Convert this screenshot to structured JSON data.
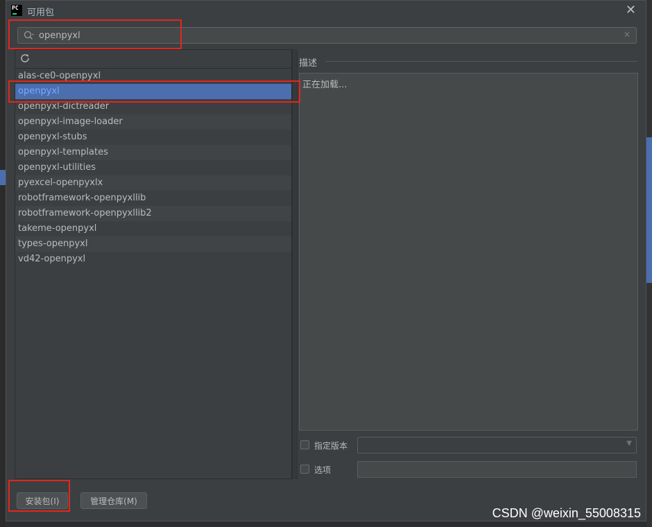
{
  "window": {
    "title": "可用包",
    "app_icon_text": "PC"
  },
  "search": {
    "value": "openpyxl"
  },
  "packages": [
    "alas-ce0-openpyxl",
    "openpyxl",
    "openpyxl-dictreader",
    "openpyxl-image-loader",
    "openpyxl-stubs",
    "openpyxl-templates",
    "openpyxl-utilities",
    "pyexcel-openpyxlx",
    "robotframework-openpyxllib",
    "robotframework-openpyxllib2",
    "takeme-openpyxl",
    "types-openpyxl",
    "vd42-openpyxl"
  ],
  "selected_package": "openpyxl",
  "description": {
    "label": "描述",
    "text": "正在加载..."
  },
  "options": {
    "specify_version_label": "指定版本",
    "options_label": "选项"
  },
  "buttons": {
    "install": "安装包(I)",
    "manage_repos": "管理仓库(M)"
  },
  "watermark": "CSDN @weixin_55008315",
  "colors": {
    "selection": "#4b6eaf",
    "highlight": "#e3261d",
    "background": "#3c3f41"
  }
}
